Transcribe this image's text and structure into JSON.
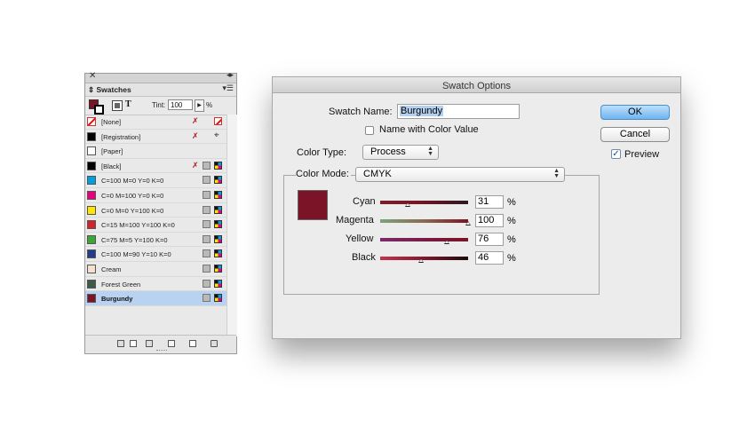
{
  "swatches_panel": {
    "close_glyph": "✕",
    "collapse_glyph": "◂▸",
    "tab_label": "Swatches",
    "menu_glyph": "▾☰",
    "tint_label": "Tint:",
    "tint_value": "100",
    "tint_arrow": "▶",
    "tint_unit": "%",
    "items": [
      {
        "name": "[None]",
        "color": "none"
      },
      {
        "name": "[Registration]",
        "color": "#000000"
      },
      {
        "name": "[Paper]",
        "color": "#ffffff"
      },
      {
        "name": "[Black]",
        "color": "#000000"
      },
      {
        "name": "C=100 M=0 Y=0 K=0",
        "color": "#00a0e0"
      },
      {
        "name": "C=0 M=100 Y=0 K=0",
        "color": "#e6007e"
      },
      {
        "name": "C=0 M=0 Y=100 K=0",
        "color": "#ffe600"
      },
      {
        "name": "C=15 M=100 Y=100 K=0",
        "color": "#d2232a"
      },
      {
        "name": "C=75 M=5 Y=100 K=0",
        "color": "#3aa638"
      },
      {
        "name": "C=100 M=90 Y=10 K=0",
        "color": "#263a8c"
      },
      {
        "name": "Cream",
        "color": "#f3e1cc"
      },
      {
        "name": "Forest Green",
        "color": "#3d5a48"
      },
      {
        "name": "Burgundy",
        "color": "#7a1426",
        "selected": true
      }
    ],
    "noedit_glyph": "✗",
    "registration_glyph": "⌖"
  },
  "dialog": {
    "title": "Swatch Options",
    "swatch_name_label": "Swatch Name:",
    "swatch_name_value": "Burgundy",
    "name_with_color_value_label": "Name with Color Value",
    "color_type_label": "Color Type:",
    "color_type_value": "Process",
    "color_mode_label": "Color Mode:",
    "color_mode_value": "CMYK",
    "swatch_color": "#7a1426",
    "channels": [
      {
        "label": "Cyan",
        "value": "31",
        "level": 31,
        "gradient": "linear-gradient(90deg,#7a1f2a,#7a1426 40%,#2a1a1e)"
      },
      {
        "label": "Magenta",
        "value": "100",
        "level": 100,
        "gradient": "linear-gradient(90deg,#7fa37c,#8a6a4e 50%,#7a1426)"
      },
      {
        "label": "Yellow",
        "value": "76",
        "level": 76,
        "gradient": "linear-gradient(90deg,#7a2b6c,#7a1a44 50%,#7a1426)"
      },
      {
        "label": "Black",
        "value": "46",
        "level": 46,
        "gradient": "linear-gradient(90deg,#c8324a,#8a1a2e 45%,#1e0a0e)"
      }
    ],
    "percent_sign": "%",
    "ok_label": "OK",
    "cancel_label": "Cancel",
    "preview_label": "Preview",
    "preview_checked": true
  }
}
